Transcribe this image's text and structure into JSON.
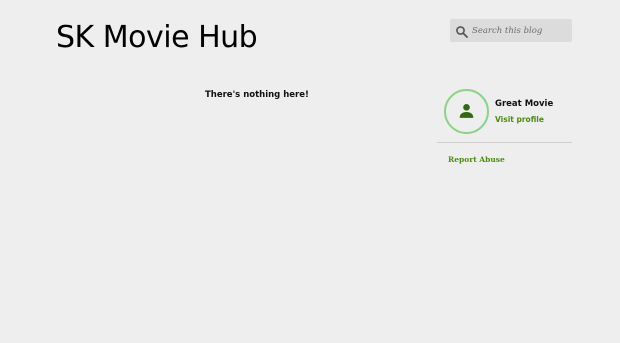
{
  "header": {
    "title": "SK Movie Hub"
  },
  "search": {
    "placeholder": "Search this blog"
  },
  "main": {
    "empty_message": "There's nothing here!"
  },
  "profile": {
    "name": "Great Movie",
    "visit_label": "Visit profile",
    "avatar_icon": "person-icon"
  },
  "footer_links": {
    "report_abuse": "Report Abuse"
  },
  "colors": {
    "background": "#eeeeee",
    "link_green": "#4e8a10",
    "avatar_ring": "#8fd08b",
    "avatar_icon": "#2f6a12"
  }
}
